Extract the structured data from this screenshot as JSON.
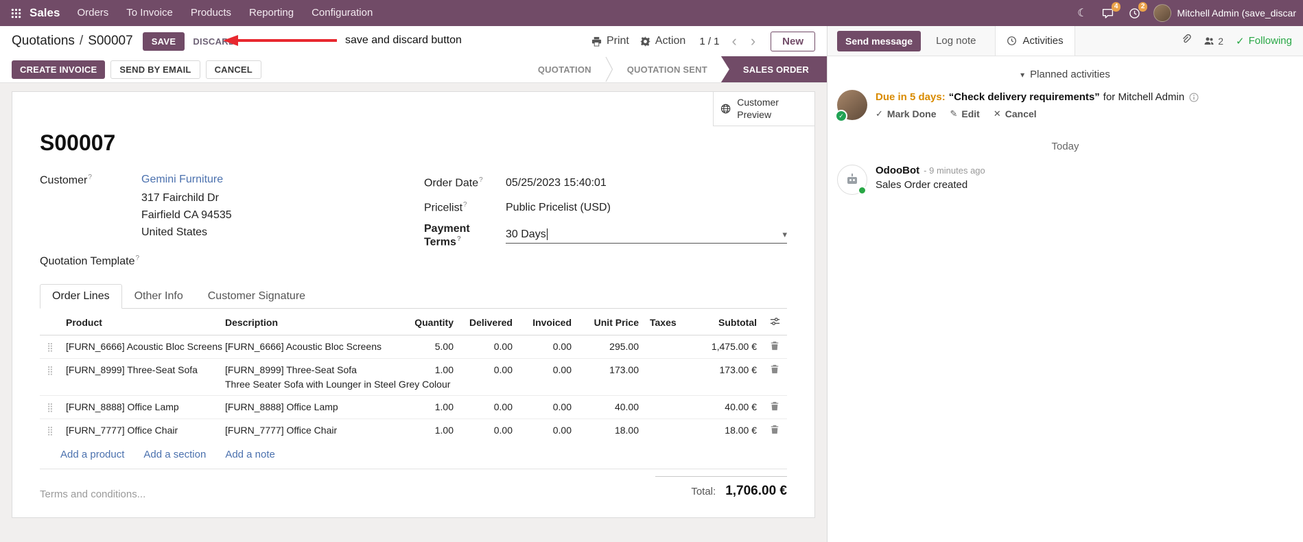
{
  "colors": {
    "brand_purple": "#714B67",
    "link_blue": "#4b71ae",
    "modified_value_blue": "#2e7cee",
    "due_warning_orange": "#d98b00",
    "following_green": "#28a745",
    "annotation_red": "#e8282f",
    "badge_orange": "#eaa24a"
  },
  "navbar": {
    "app_name": "Sales",
    "menus": [
      "Orders",
      "To Invoice",
      "Products",
      "Reporting",
      "Configuration"
    ],
    "messages_badge": "4",
    "activities_badge": "2",
    "user_name": "Mitchell Admin (save_discar"
  },
  "breadcrumb": {
    "parent": "Quotations",
    "separator": "/",
    "current": "S00007",
    "save_label": "SAVE",
    "discard_label": "DISCARD"
  },
  "annotation": {
    "text": "save and discard button"
  },
  "control_panel": {
    "print_label": "Print",
    "action_label": "Action",
    "pager": "1 / 1",
    "new_label": "New"
  },
  "statusbar": {
    "buttons": [
      "CREATE INVOICE",
      "SEND BY EMAIL",
      "CANCEL"
    ],
    "stages": [
      {
        "label": "QUOTATION",
        "active": false
      },
      {
        "label": "QUOTATION SENT",
        "active": false
      },
      {
        "label": "SALES ORDER",
        "active": true
      }
    ]
  },
  "form": {
    "customer_preview_label": "Customer Preview",
    "title": "S00007",
    "help_marker": "?",
    "fields": {
      "customer_label": "Customer",
      "customer_name": "Gemini Furniture",
      "customer_address": [
        "317 Fairchild Dr",
        "Fairfield CA 94535",
        "United States"
      ],
      "quotation_template_label": "Quotation Template",
      "order_date_label": "Order Date",
      "order_date_value": "05/25/2023 15:40:01",
      "pricelist_label": "Pricelist",
      "pricelist_value": "Public Pricelist (USD)",
      "payment_terms_label": "Payment Terms",
      "payment_terms_value": "30 Days"
    },
    "tabs": [
      "Order Lines",
      "Other Info",
      "Customer Signature"
    ],
    "order_lines": {
      "columns": [
        "Product",
        "Description",
        "Quantity",
        "Delivered",
        "Invoiced",
        "Unit Price",
        "Taxes",
        "Subtotal"
      ],
      "rows": [
        {
          "product": "[FURN_6666] Acoustic Bloc Screens",
          "description": "[FURN_6666] Acoustic Bloc Screens",
          "description2": "",
          "quantity": "5.00",
          "delivered": "0.00",
          "invoiced": "0.00",
          "unit_price": "295.00",
          "taxes": "",
          "subtotal": "1,475.00 €"
        },
        {
          "product": "[FURN_8999] Three-Seat Sofa",
          "description": "[FURN_8999] Three-Seat Sofa",
          "description2": "Three Seater Sofa with Lounger in Steel Grey Colour",
          "quantity": "1.00",
          "delivered": "0.00",
          "invoiced": "0.00",
          "unit_price": "173.00",
          "taxes": "",
          "subtotal": "173.00 €"
        },
        {
          "product": "[FURN_8888] Office Lamp",
          "description": "[FURN_8888] Office Lamp",
          "description2": "",
          "quantity": "1.00",
          "delivered": "0.00",
          "invoiced": "0.00",
          "unit_price": "40.00",
          "taxes": "",
          "subtotal": "40.00 €"
        },
        {
          "product": "[FURN_7777] Office Chair",
          "description": "[FURN_7777] Office Chair",
          "description2": "",
          "quantity": "1.00",
          "delivered": "0.00",
          "invoiced": "0.00",
          "unit_price": "18.00",
          "taxes": "",
          "subtotal": "18.00 €"
        }
      ],
      "footer_links": [
        "Add a product",
        "Add a section",
        "Add a note"
      ]
    },
    "terms_placeholder": "Terms and conditions...",
    "total_label": "Total:",
    "total_value": "1,706.00 €"
  },
  "chatter": {
    "send_message_label": "Send message",
    "log_note_label": "Log note",
    "activities_label": "Activities",
    "followers_count": "2",
    "following_label": "Following",
    "planned_header": "Planned activities",
    "activity": {
      "due": "Due in 5 days:",
      "summary": "“Check delivery requirements”",
      "for_text": "for Mitchell Admin",
      "actions": [
        "Mark Done",
        "Edit",
        "Cancel"
      ]
    },
    "today_label": "Today",
    "message": {
      "author": "OdooBot",
      "time": "- 9 minutes ago",
      "body": "Sales Order created"
    }
  }
}
